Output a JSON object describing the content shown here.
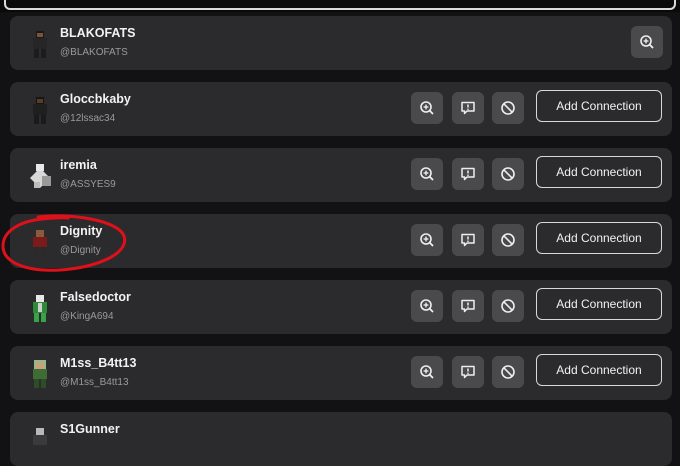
{
  "connections": [
    {
      "name": "BLAKOFATS",
      "handle": "@BLAKOFATS",
      "is_connection": true
    },
    {
      "name": "Gloccbkaby",
      "handle": "@12lssac34",
      "add_label": "Add Connection"
    },
    {
      "name": "iremia",
      "handle": "@ASSYES9",
      "add_label": "Add Connection"
    },
    {
      "name": "Dignity",
      "handle": "@Dignity",
      "add_label": "Add Connection",
      "circled": true
    },
    {
      "name": "Falsedoctor",
      "handle": "@KingA694",
      "add_label": "Add Connection"
    },
    {
      "name": "M1ss_B4tt13",
      "handle": "@M1ss_B4tt13",
      "add_label": "Add Connection"
    },
    {
      "name": "S1Gunner"
    }
  ],
  "icons": {
    "view": "zoom-in-icon",
    "report": "report-icon",
    "block": "block-icon"
  },
  "colors": {
    "card": "#2b2b2d",
    "button": "#4a4a4d",
    "annotation": "#e0101a",
    "background": "#121214"
  }
}
